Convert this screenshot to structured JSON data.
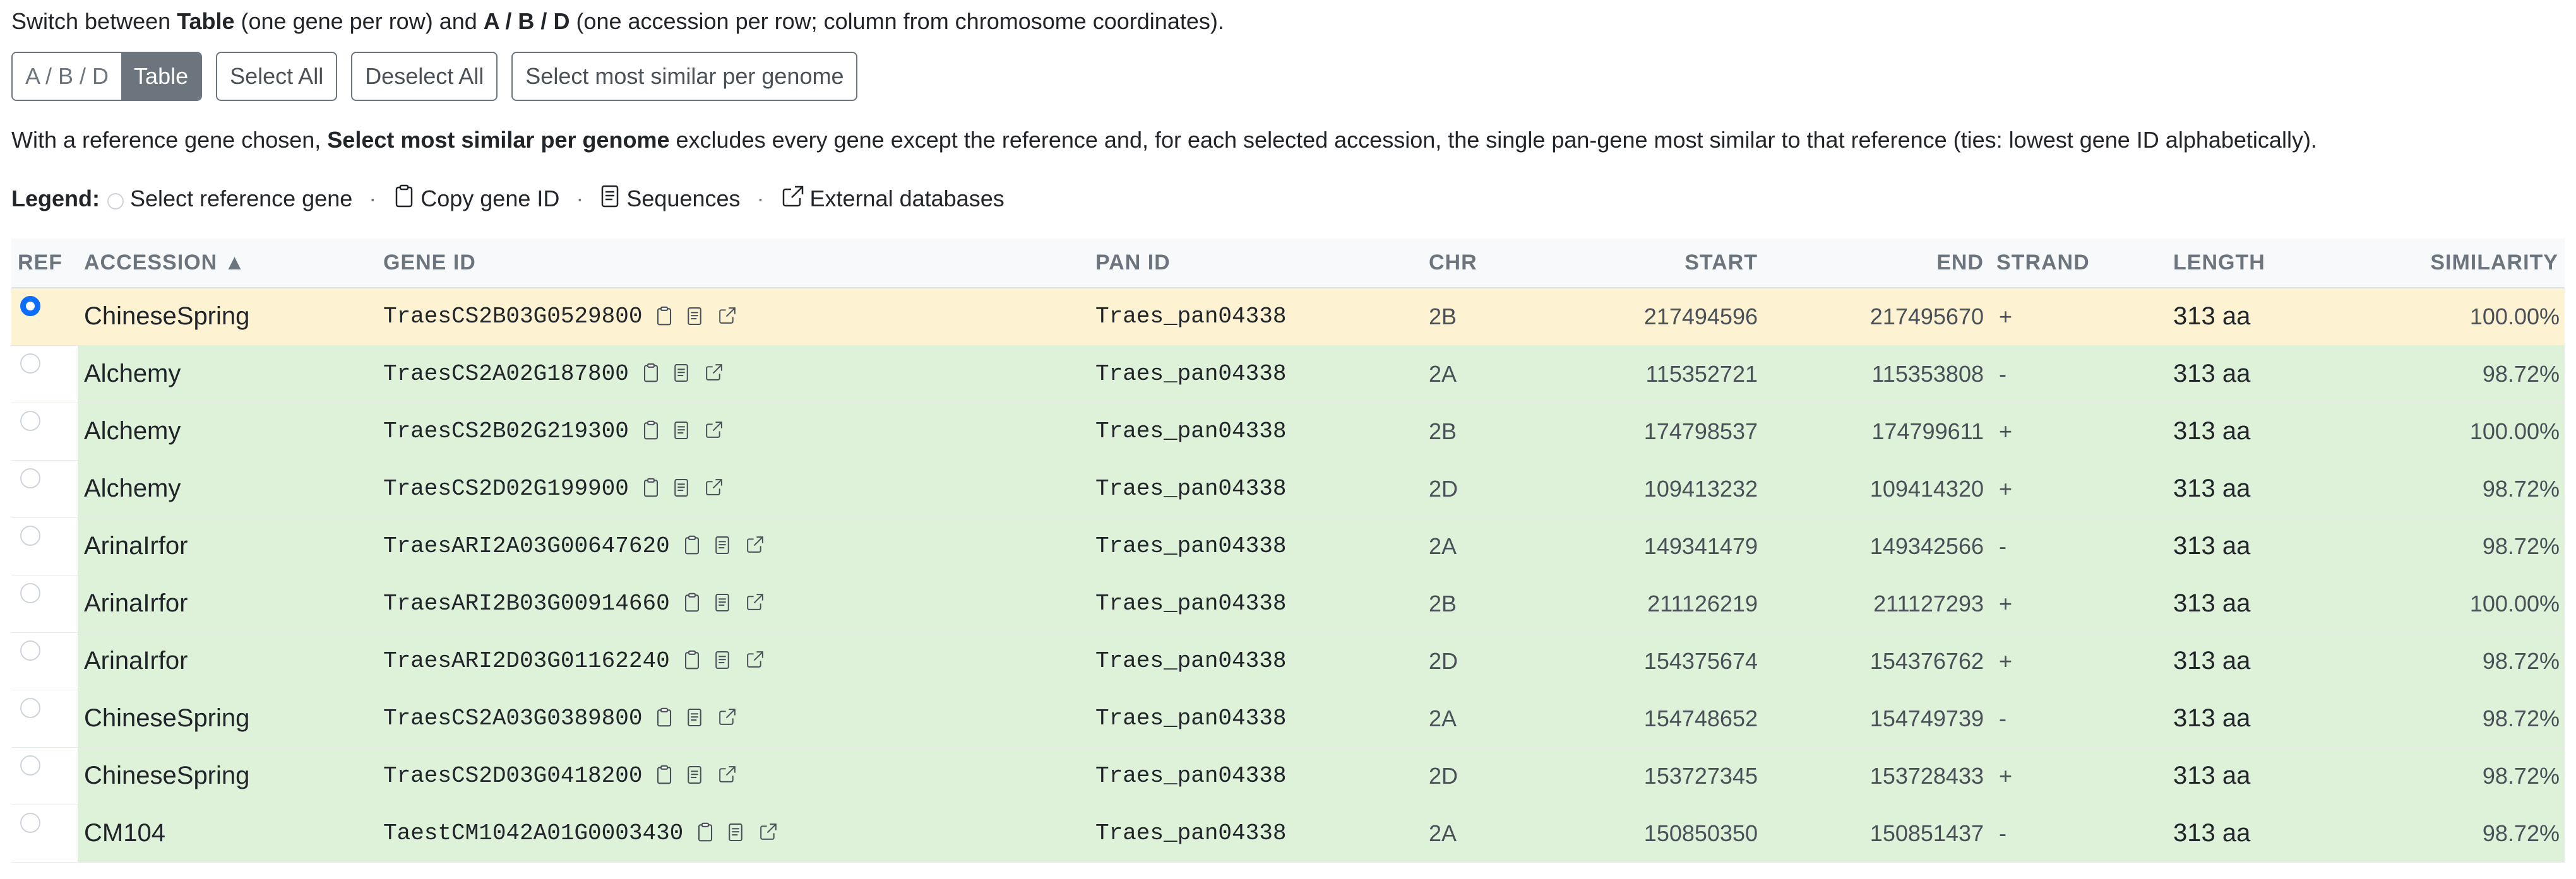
{
  "intro": {
    "p1": "Switch between ",
    "b1": "Table",
    "p2": " (one gene per row) and ",
    "b2": "A / B / D",
    "p3": " (one accession per row; column from chromosome coordinates)."
  },
  "toolbar": {
    "view_abd": "A / B / D",
    "view_table": "Table",
    "active_view": "Table",
    "select_all": "Select All",
    "deselect_all": "Deselect All",
    "select_most_similar": "Select most similar per genome"
  },
  "note": {
    "p1": "With a reference gene chosen, ",
    "b1": "Select most similar per genome",
    "p2": " excludes every gene except the reference and, for each selected accession, the single pan-gene most similar to that reference (ties: lowest gene ID alphabetically)."
  },
  "legend": {
    "label": "Legend:",
    "select_ref": "Select reference gene",
    "copy_id": "Copy gene ID",
    "sequences": "Sequences",
    "external": "External databases",
    "separator": "·"
  },
  "table": {
    "headers": {
      "ref": "REF",
      "accession": "ACCESSION ▲",
      "gene_id": "GENE ID",
      "pan_id": "PAN ID",
      "chr": "CHR",
      "start": "START",
      "end": "END",
      "strand": "STRAND",
      "length": "LENGTH",
      "similarity": "SIMILARITY"
    },
    "rows": [
      {
        "ref": true,
        "accession": "ChineseSpring",
        "gene_id": "TraesCS2B03G0529800",
        "pan_id": "Traes_pan04338",
        "chr": "2B",
        "start": "217494596",
        "end": "217495670",
        "strand": "+",
        "length": "313 aa",
        "similarity": "100.00%"
      },
      {
        "ref": false,
        "accession": "Alchemy",
        "gene_id": "TraesCS2A02G187800",
        "pan_id": "Traes_pan04338",
        "chr": "2A",
        "start": "115352721",
        "end": "115353808",
        "strand": "-",
        "length": "313 aa",
        "similarity": "98.72%"
      },
      {
        "ref": false,
        "accession": "Alchemy",
        "gene_id": "TraesCS2B02G219300",
        "pan_id": "Traes_pan04338",
        "chr": "2B",
        "start": "174798537",
        "end": "174799611",
        "strand": "+",
        "length": "313 aa",
        "similarity": "100.00%"
      },
      {
        "ref": false,
        "accession": "Alchemy",
        "gene_id": "TraesCS2D02G199900",
        "pan_id": "Traes_pan04338",
        "chr": "2D",
        "start": "109413232",
        "end": "109414320",
        "strand": "+",
        "length": "313 aa",
        "similarity": "98.72%"
      },
      {
        "ref": false,
        "accession": "ArinaIrfor",
        "gene_id": "TraesARI2A03G00647620",
        "pan_id": "Traes_pan04338",
        "chr": "2A",
        "start": "149341479",
        "end": "149342566",
        "strand": "-",
        "length": "313 aa",
        "similarity": "98.72%"
      },
      {
        "ref": false,
        "accession": "ArinaIrfor",
        "gene_id": "TraesARI2B03G00914660",
        "pan_id": "Traes_pan04338",
        "chr": "2B",
        "start": "211126219",
        "end": "211127293",
        "strand": "+",
        "length": "313 aa",
        "similarity": "100.00%"
      },
      {
        "ref": false,
        "accession": "ArinaIrfor",
        "gene_id": "TraesARI2D03G01162240",
        "pan_id": "Traes_pan04338",
        "chr": "2D",
        "start": "154375674",
        "end": "154376762",
        "strand": "+",
        "length": "313 aa",
        "similarity": "98.72%"
      },
      {
        "ref": false,
        "accession": "ChineseSpring",
        "gene_id": "TraesCS2A03G0389800",
        "pan_id": "Traes_pan04338",
        "chr": "2A",
        "start": "154748652",
        "end": "154749739",
        "strand": "-",
        "length": "313 aa",
        "similarity": "98.72%"
      },
      {
        "ref": false,
        "accession": "ChineseSpring",
        "gene_id": "TraesCS2D03G0418200",
        "pan_id": "Traes_pan04338",
        "chr": "2D",
        "start": "153727345",
        "end": "153728433",
        "strand": "+",
        "length": "313 aa",
        "similarity": "98.72%"
      },
      {
        "ref": false,
        "accession": "CM104",
        "gene_id": "TaestCM1042A01G0003430",
        "pan_id": "Traes_pan04338",
        "chr": "2A",
        "start": "150850350",
        "end": "150851437",
        "strand": "-",
        "length": "313 aa",
        "similarity": "98.72%"
      }
    ]
  },
  "colors": {
    "ref_row": "#fdf3d3",
    "other_row": "#def2da",
    "radio_selected": "#0d6efd",
    "button_border": "#6c757d"
  },
  "icons": [
    "copy-icon",
    "sequences-icon",
    "external-link-icon"
  ]
}
